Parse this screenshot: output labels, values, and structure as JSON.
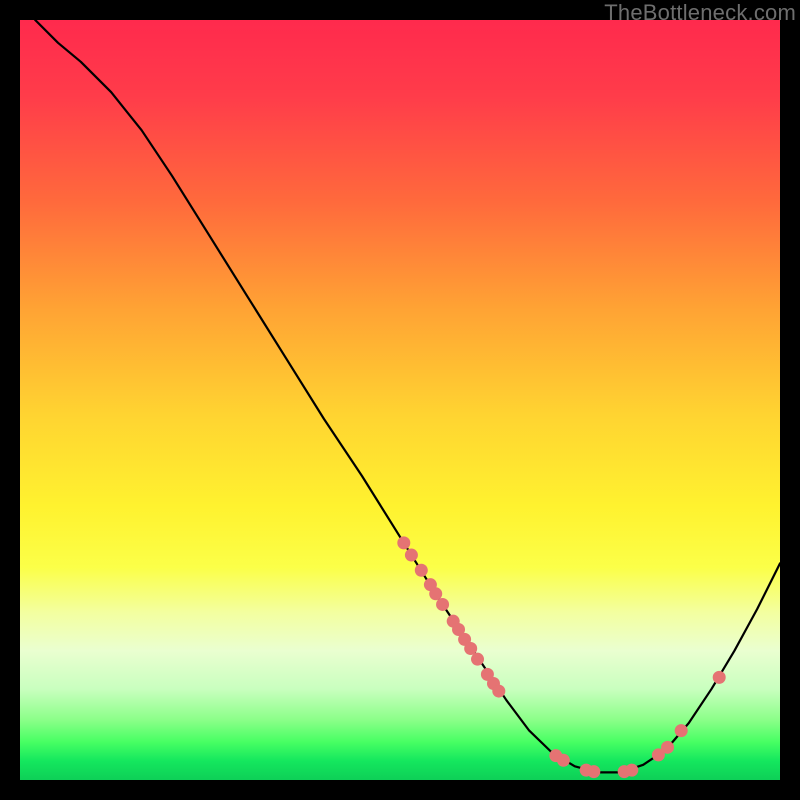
{
  "watermark": "TheBottleneck.com",
  "colors": {
    "curve": "#000000",
    "dot_fill": "#e57373",
    "dot_stroke": "#df6c6c"
  },
  "chart_data": {
    "type": "line",
    "title": "",
    "xlabel": "",
    "ylabel": "",
    "xlim": [
      0,
      100
    ],
    "ylim": [
      0,
      100
    ],
    "curve": [
      {
        "x": 2.0,
        "y": 100.0
      },
      {
        "x": 5.0,
        "y": 97.0
      },
      {
        "x": 8.0,
        "y": 94.5
      },
      {
        "x": 12.0,
        "y": 90.5
      },
      {
        "x": 16.0,
        "y": 85.5
      },
      {
        "x": 20.0,
        "y": 79.5
      },
      {
        "x": 25.0,
        "y": 71.5
      },
      {
        "x": 30.0,
        "y": 63.5
      },
      {
        "x": 35.0,
        "y": 55.5
      },
      {
        "x": 40.0,
        "y": 47.5
      },
      {
        "x": 45.0,
        "y": 40.0
      },
      {
        "x": 50.0,
        "y": 32.0
      },
      {
        "x": 55.0,
        "y": 24.0
      },
      {
        "x": 60.0,
        "y": 16.5
      },
      {
        "x": 64.0,
        "y": 10.5
      },
      {
        "x": 67.0,
        "y": 6.5
      },
      {
        "x": 70.0,
        "y": 3.6
      },
      {
        "x": 73.0,
        "y": 1.8
      },
      {
        "x": 76.0,
        "y": 1.0
      },
      {
        "x": 79.0,
        "y": 1.0
      },
      {
        "x": 82.0,
        "y": 2.0
      },
      {
        "x": 85.0,
        "y": 4.0
      },
      {
        "x": 88.0,
        "y": 7.5
      },
      {
        "x": 91.0,
        "y": 12.0
      },
      {
        "x": 94.0,
        "y": 17.0
      },
      {
        "x": 97.0,
        "y": 22.5
      },
      {
        "x": 100.0,
        "y": 28.5
      }
    ],
    "series": [
      {
        "name": "cluster-mid-slope",
        "type": "scatter",
        "points": [
          {
            "x": 50.5,
            "y": 31.2
          },
          {
            "x": 51.5,
            "y": 29.6
          },
          {
            "x": 52.8,
            "y": 27.6
          },
          {
            "x": 54.0,
            "y": 25.7
          },
          {
            "x": 54.7,
            "y": 24.5
          },
          {
            "x": 55.6,
            "y": 23.1
          },
          {
            "x": 57.0,
            "y": 20.9
          },
          {
            "x": 57.7,
            "y": 19.8
          },
          {
            "x": 58.5,
            "y": 18.5
          },
          {
            "x": 59.3,
            "y": 17.3
          },
          {
            "x": 60.2,
            "y": 15.9
          },
          {
            "x": 61.5,
            "y": 13.9
          },
          {
            "x": 62.3,
            "y": 12.7
          },
          {
            "x": 63.0,
            "y": 11.7
          }
        ]
      },
      {
        "name": "cluster-valley",
        "type": "scatter",
        "points": [
          {
            "x": 70.5,
            "y": 3.2
          },
          {
            "x": 71.5,
            "y": 2.6
          },
          {
            "x": 74.5,
            "y": 1.3
          },
          {
            "x": 75.5,
            "y": 1.1
          },
          {
            "x": 79.5,
            "y": 1.1
          },
          {
            "x": 80.5,
            "y": 1.3
          },
          {
            "x": 84.0,
            "y": 3.3
          },
          {
            "x": 85.2,
            "y": 4.3
          },
          {
            "x": 87.0,
            "y": 6.5
          }
        ]
      },
      {
        "name": "point-right-rise",
        "type": "scatter",
        "points": [
          {
            "x": 92.0,
            "y": 13.5
          }
        ]
      }
    ]
  }
}
